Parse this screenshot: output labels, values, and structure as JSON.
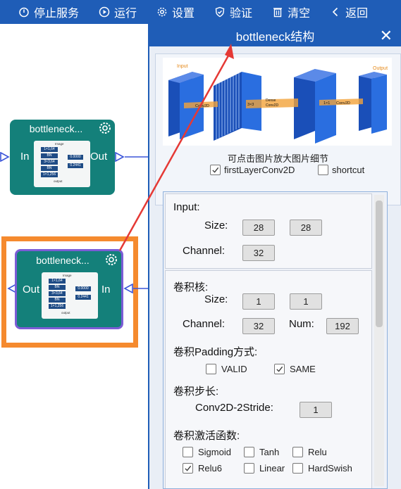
{
  "toolbar": {
    "stop": "停止服务",
    "run": "运行",
    "settings": "设置",
    "verify": "验证",
    "clear": "清空",
    "back": "返回"
  },
  "nodes": {
    "node1": {
      "title": "bottleneck...",
      "in": "In",
      "out": "Out"
    },
    "node2": {
      "title": "bottleneck...",
      "in": "In",
      "out": "Out"
    },
    "thumb": {
      "image": "Image",
      "bn": "BN",
      "k1": "1×1,64",
      "k2": "3×3,64",
      "k3": "1×1,256",
      "v1": "0.0000",
      "v2": "0.2441",
      "output": "output"
    }
  },
  "dialog": {
    "title": "bottleneck结构",
    "close": "✕",
    "diagram": {
      "input_label": "Input",
      "output_label": "Output",
      "conv2d_a": "Conv2D",
      "k3x3": "3×3",
      "dw_line1": "Dense",
      "dw_line2": "Conv2D",
      "k1x1": "1×1",
      "conv2d_b": "Conv2D"
    },
    "caption": "可点击图片放大图片细节",
    "first_layer_label": "firstLayerConv2D",
    "first_layer_checked": true,
    "shortcut_label": "shortcut",
    "shortcut_checked": false
  },
  "input_section": {
    "heading": "Input:",
    "size_label": "Size:",
    "size_w": "28",
    "size_h": "28",
    "channel_label": "Channel:",
    "channel": "32"
  },
  "kernel_section": {
    "heading": "卷积核:",
    "size_label": "Size:",
    "size_w": "1",
    "size_h": "1",
    "channel_label": "Channel:",
    "channel": "32",
    "num_label": "Num:",
    "num": "192",
    "padding_heading": "卷积Padding方式:",
    "padding_options": [
      {
        "label": "VALID",
        "checked": false
      },
      {
        "label": "SAME",
        "checked": true
      }
    ],
    "stride_heading": "卷积步长:",
    "stride_label": "Conv2D-2Stride:",
    "stride": "1",
    "activation_heading": "卷积激活函数:",
    "activations": [
      {
        "label": "Sigmoid",
        "checked": false
      },
      {
        "label": "Tanh",
        "checked": false
      },
      {
        "label": "Relu",
        "checked": false
      },
      {
        "label": "Relu6",
        "checked": true
      },
      {
        "label": "Linear",
        "checked": false
      },
      {
        "label": "HardSwish",
        "checked": false
      }
    ]
  },
  "colors": {
    "toolbar": "#1f5db7",
    "node": "#14807a",
    "selection": "#f58a2e",
    "arrow": "#e53935",
    "block": "#1f5fd0"
  }
}
